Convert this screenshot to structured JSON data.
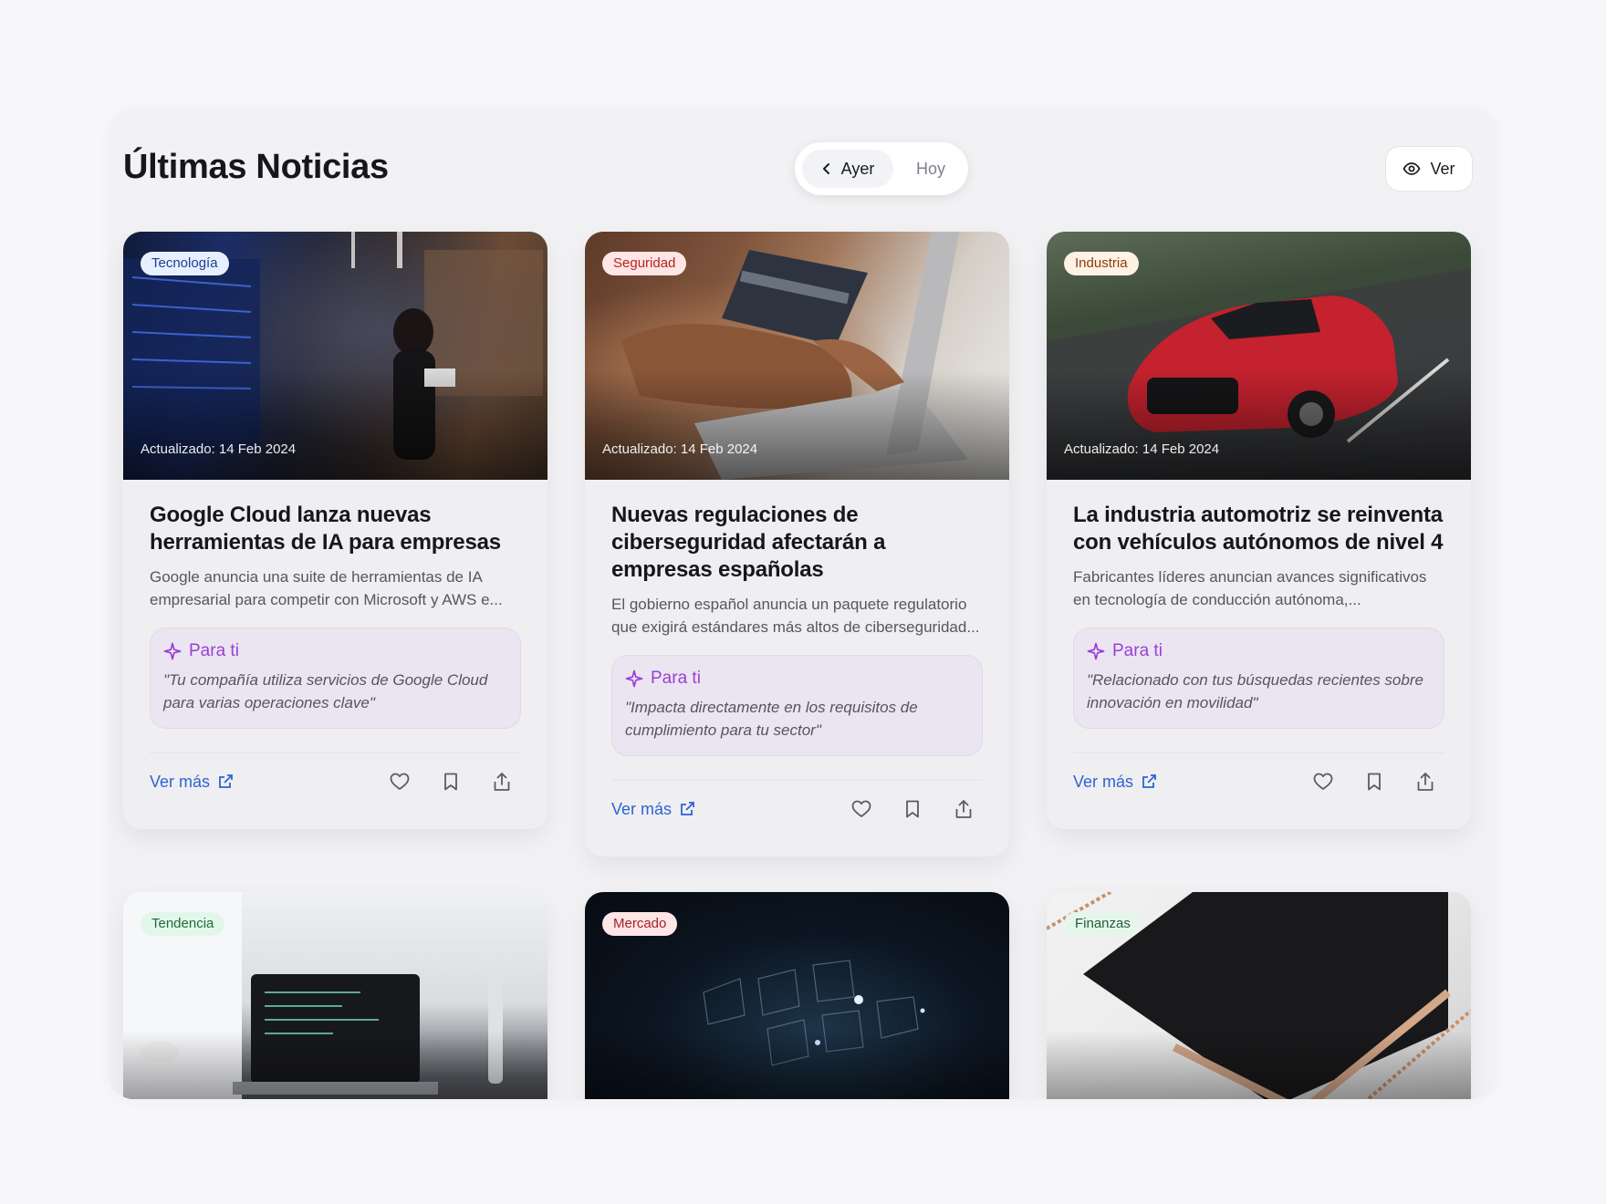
{
  "header": {
    "title": "Últimas Noticias",
    "day_toggle": {
      "previous_label": "Ayer",
      "next_label": "Hoy",
      "selected": "Ayer"
    },
    "view_button_label": "Ver"
  },
  "cards": [
    {
      "category": "Tecnología",
      "updated": "Actualizado: 14 Feb 2024",
      "title": "Google Cloud lanza nuevas herramientas de IA para empresas",
      "description": "Google anuncia una suite de herramientas de IA empresarial para competir con Microsoft y AWS e...",
      "para_ti_label": "Para ti",
      "para_ti_reason": "\"Tu compañía utiliza servicios de Google Cloud para varias operaciones clave\"",
      "ver_mas": "Ver más"
    },
    {
      "category": "Seguridad",
      "updated": "Actualizado: 14 Feb 2024",
      "title": "Nuevas regulaciones de ciberseguridad afectarán a empresas españolas",
      "description": "El gobierno español anuncia un paquete regulatorio que exigirá estándares más altos de ciberseguridad...",
      "para_ti_label": "Para ti",
      "para_ti_reason": "\"Impacta directamente en los requisitos de cumplimiento para tu sector\"",
      "ver_mas": "Ver más"
    },
    {
      "category": "Industria",
      "updated": "Actualizado: 14 Feb 2024",
      "title": "La industria automotriz se reinventa con vehículos autónomos de nivel 4",
      "description": "Fabricantes líderes anuncian avances significativos en tecnología de conducción autónoma,...",
      "para_ti_label": "Para ti",
      "para_ti_reason": "\"Relacionado con tus búsquedas recientes sobre innovación en movilidad\"",
      "ver_mas": "Ver más"
    },
    {
      "category": "Tendencia"
    },
    {
      "category": "Mercado"
    },
    {
      "category": "Finanzas"
    }
  ],
  "colors": {
    "accent_link": "#2f62d6",
    "para_ti_accent": "#9a3fd4",
    "badge_tecnologia": "#e6efff",
    "badge_seguridad": "#ffe5e5",
    "badge_industria": "#fff1e3",
    "badge_tendencia": "#e2f7ea",
    "badge_mercado": "#ffe6e6",
    "badge_finanzas": "#e6f6ea"
  },
  "icons": {
    "toggle_previous": "chevron-left-icon",
    "view": "eye-icon",
    "para_ti": "sparkle-icon",
    "ver_mas": "external-link-icon",
    "like": "heart-icon",
    "save": "bookmark-icon",
    "share": "share-icon"
  }
}
